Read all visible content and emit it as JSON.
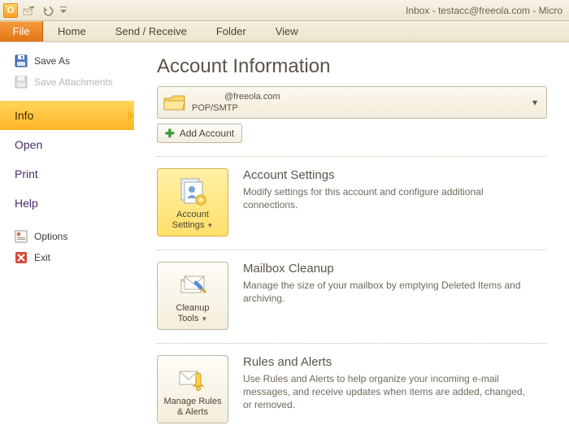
{
  "window": {
    "title": "Inbox - testacc@freeola.com  -  Micro"
  },
  "ribbon": {
    "file": "File",
    "tabs": [
      "Home",
      "Send / Receive",
      "Folder",
      "View"
    ]
  },
  "nav": {
    "save_as": "Save As",
    "save_attachments": "Save Attachments",
    "info": "Info",
    "open": "Open",
    "print": "Print",
    "help": "Help",
    "options": "Options",
    "exit": "Exit"
  },
  "main": {
    "heading": "Account Information",
    "account": {
      "email": "@freeola.com",
      "protocol": "POP/SMTP"
    },
    "add_account": "Add Account",
    "blocks": {
      "settings": {
        "button": "Account Settings",
        "title": "Account Settings",
        "desc": "Modify settings for this account and configure additional connections."
      },
      "cleanup": {
        "button": "Cleanup Tools",
        "title": "Mailbox Cleanup",
        "desc": "Manage the size of your mailbox by emptying Deleted Items and archiving."
      },
      "rules": {
        "button": "Manage Rules & Alerts",
        "title": "Rules and Alerts",
        "desc": "Use Rules and Alerts to help organize your incoming e-mail messages, and receive updates when items are added, changed, or removed."
      }
    }
  }
}
